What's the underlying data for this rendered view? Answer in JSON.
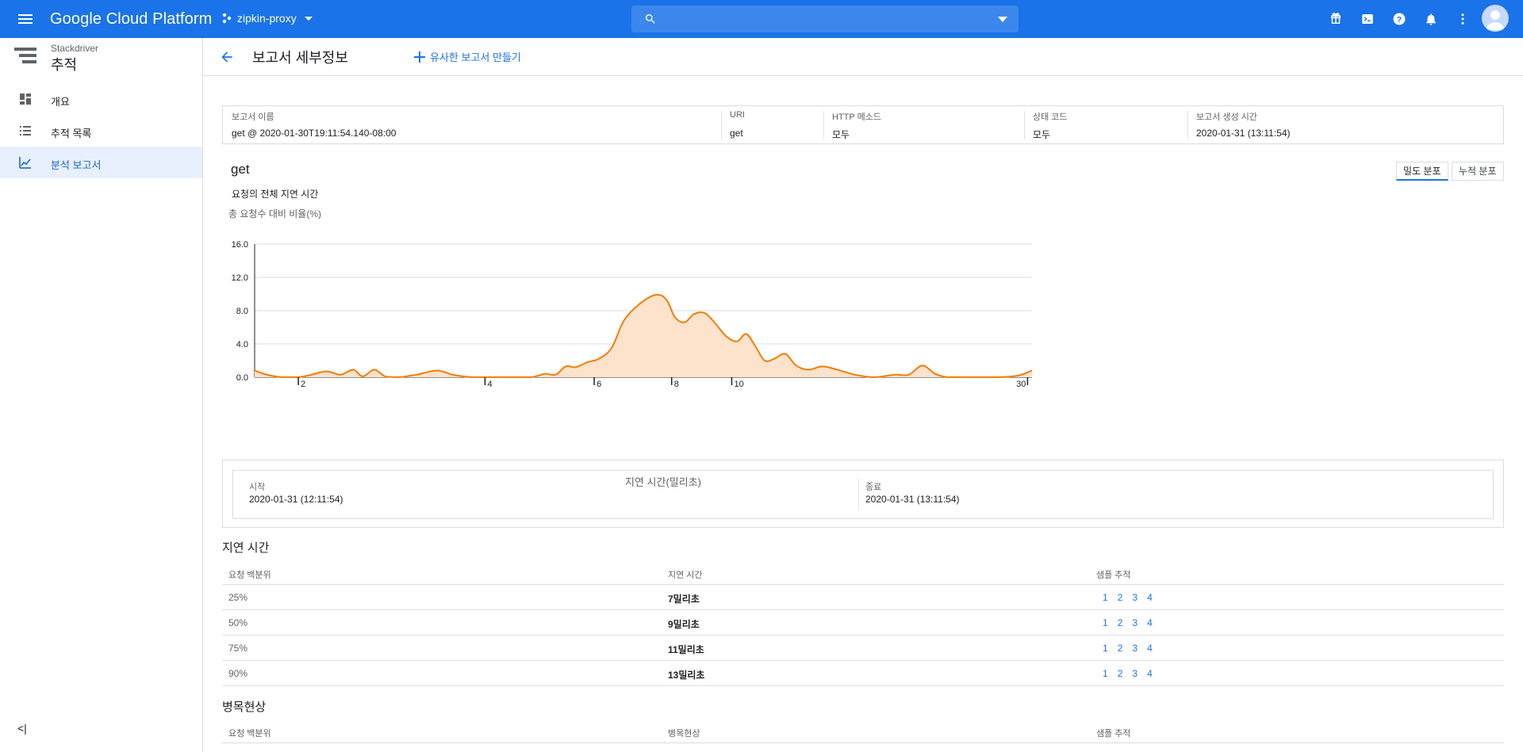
{
  "topbar": {
    "brand": "Google Cloud Platform",
    "project": "zipkin-proxy",
    "search_value": "",
    "icons": [
      "gift-icon",
      "cloud-shell-icon",
      "help-icon",
      "notifications-icon",
      "more-vert-icon",
      "account-avatar"
    ],
    "accent": "#1a73e8"
  },
  "sidebar": {
    "product_sub": "Stackdriver",
    "product_title": "추적",
    "items": [
      {
        "label": "개요",
        "icon": "dashboard-icon",
        "active": false
      },
      {
        "label": "추적 목록",
        "icon": "list-icon",
        "active": false
      },
      {
        "label": "분석 보고서",
        "icon": "analytics-icon",
        "active": true
      }
    ],
    "collapse_label": "<|"
  },
  "header": {
    "title": "보고서 세부정보",
    "similar_label": "유사한 보고서 만들기"
  },
  "info": [
    {
      "label": "보고서 이름",
      "value": "get @ 2020-01-30T19:11:54.140-08:00"
    },
    {
      "label": "URI",
      "value": "get"
    },
    {
      "label": "HTTP 메소드",
      "value": "모두"
    },
    {
      "label": "상태 코드",
      "value": "모두"
    },
    {
      "label": "보고서 생성 시간",
      "value": "2020-01-31 (13:11:54)"
    }
  ],
  "report_name": "get",
  "toggles": {
    "density": "밀도 분포",
    "cumulative": "누적 분포"
  },
  "chart_data": {
    "type": "area",
    "title": "요청의 전체 지연 시간",
    "ylabel": "총 요청수 대비 비율(%)",
    "xlabel": "지연 시간(밀리초)",
    "ylim": [
      0,
      16
    ],
    "yticks": [
      "0.0",
      "4.0",
      "8.0",
      "12.0",
      "16.0"
    ],
    "xticks": [
      "2",
      "4",
      "6",
      "8",
      "10",
      "30"
    ],
    "x_scale": "log",
    "color": "#f57c00",
    "fill": "#fde3cc",
    "series": [
      {
        "points": [
          [
            1.7,
            0.8
          ],
          [
            1.78,
            0.3
          ],
          [
            1.88,
            0.0
          ],
          [
            2.0,
            0.0
          ],
          [
            2.1,
            0.3
          ],
          [
            2.22,
            0.7
          ],
          [
            2.34,
            0.3
          ],
          [
            2.45,
            0.9
          ],
          [
            2.54,
            0.1
          ],
          [
            2.65,
            0.9
          ],
          [
            2.76,
            0.1
          ],
          [
            2.9,
            0.0
          ],
          [
            3.1,
            0.3
          ],
          [
            3.35,
            0.8
          ],
          [
            3.55,
            0.3
          ],
          [
            3.8,
            0.0
          ],
          [
            4.1,
            0.0
          ],
          [
            4.4,
            0.0
          ],
          [
            4.75,
            0.0
          ],
          [
            5.0,
            0.4
          ],
          [
            5.2,
            0.3
          ],
          [
            5.4,
            1.3
          ],
          [
            5.6,
            1.2
          ],
          [
            5.85,
            1.8
          ],
          [
            6.1,
            2.2
          ],
          [
            6.4,
            3.5
          ],
          [
            6.7,
            6.8
          ],
          [
            7.1,
            8.8
          ],
          [
            7.55,
            9.9
          ],
          [
            7.85,
            9.3
          ],
          [
            8.1,
            7.2
          ],
          [
            8.4,
            6.6
          ],
          [
            8.7,
            7.6
          ],
          [
            9.05,
            7.7
          ],
          [
            9.4,
            6.5
          ],
          [
            9.8,
            4.9
          ],
          [
            10.2,
            4.3
          ],
          [
            10.55,
            5.2
          ],
          [
            10.9,
            3.8
          ],
          [
            11.3,
            2.0
          ],
          [
            11.7,
            2.2
          ],
          [
            12.2,
            2.8
          ],
          [
            12.7,
            1.4
          ],
          [
            13.3,
            0.9
          ],
          [
            14.0,
            1.3
          ],
          [
            14.8,
            0.9
          ],
          [
            15.8,
            0.3
          ],
          [
            17.0,
            0.0
          ],
          [
            18.3,
            0.3
          ],
          [
            19.3,
            0.3
          ],
          [
            20.3,
            1.4
          ],
          [
            21.3,
            0.4
          ],
          [
            22.3,
            0.0
          ],
          [
            24.0,
            0.0
          ],
          [
            27.0,
            0.0
          ],
          [
            29.0,
            0.2
          ],
          [
            30.5,
            0.8
          ]
        ]
      }
    ]
  },
  "range": {
    "start_label": "시작",
    "start_value": "2020-01-31 (12:11:54)",
    "end_label": "종료",
    "end_value": "2020-01-31 (13:11:54)"
  },
  "latency": {
    "title": "지연 시간",
    "headers": [
      "요청 백분위",
      "지연 시간",
      "샘플 추적"
    ],
    "rows": [
      {
        "pct": "25%",
        "latency": "7밀리초",
        "samples": [
          "1",
          "2",
          "3",
          "4"
        ]
      },
      {
        "pct": "50%",
        "latency": "9밀리초",
        "samples": [
          "1",
          "2",
          "3",
          "4"
        ]
      },
      {
        "pct": "75%",
        "latency": "11밀리초",
        "samples": [
          "1",
          "2",
          "3",
          "4"
        ]
      },
      {
        "pct": "90%",
        "latency": "13밀리초",
        "samples": [
          "1",
          "2",
          "3",
          "4"
        ]
      }
    ]
  },
  "bottleneck": {
    "title": "병목현상",
    "headers": [
      "요청 백분위",
      "병목현상",
      "샘플 추적"
    ]
  }
}
